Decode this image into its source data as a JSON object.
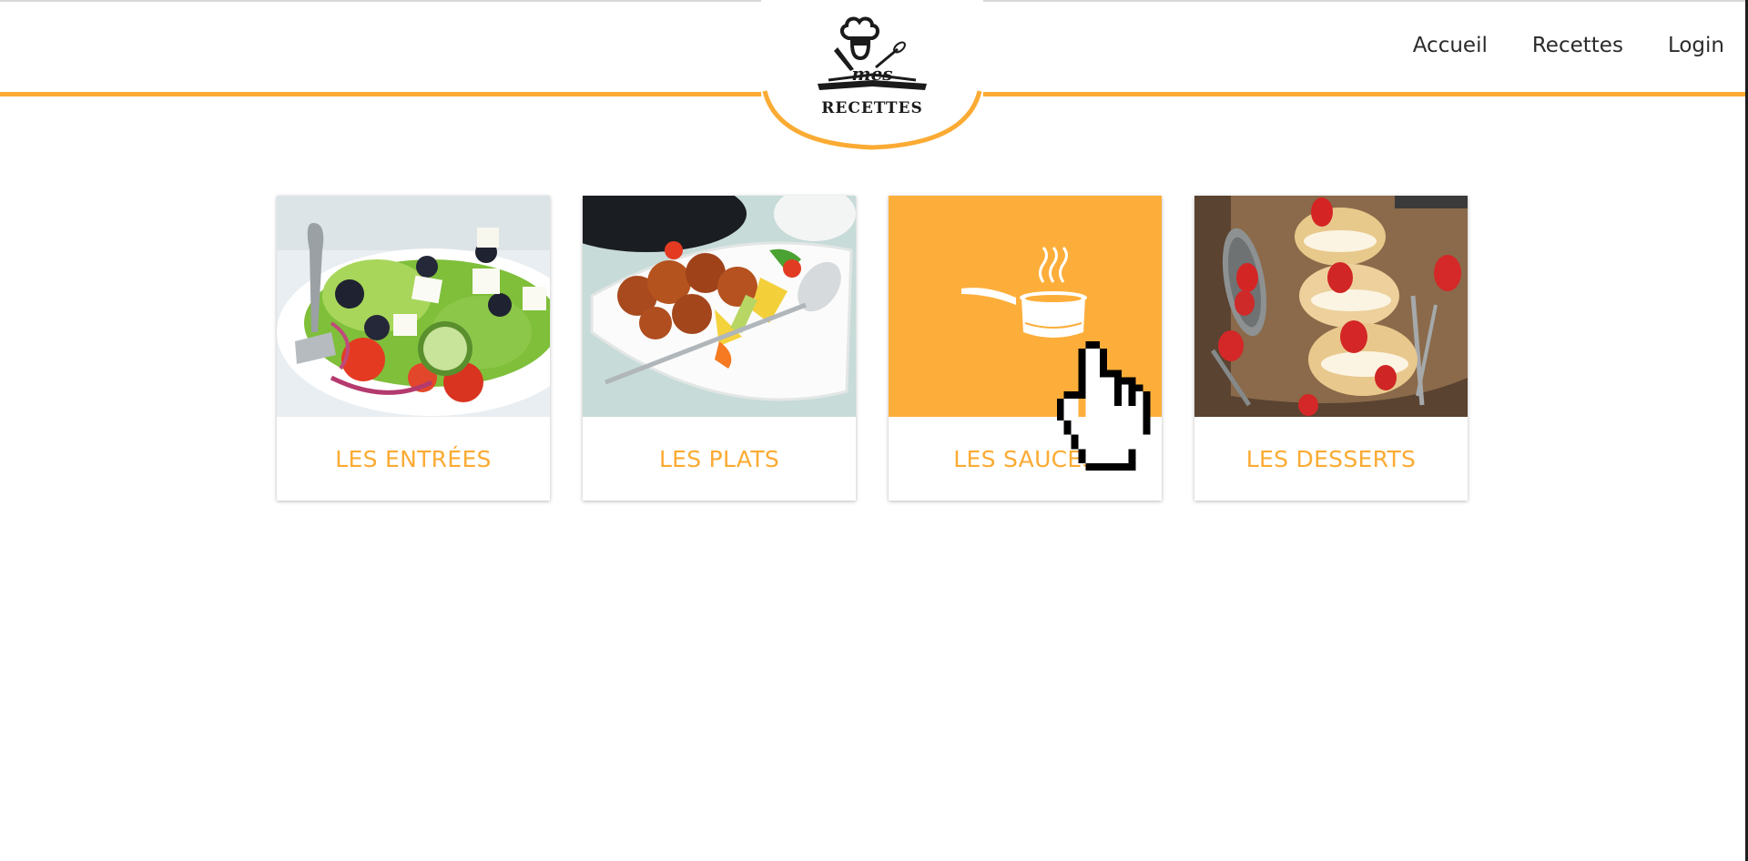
{
  "header": {
    "logo": {
      "top_text": "mes",
      "bottom_text": "RECETTES"
    },
    "nav": [
      {
        "label": "Accueil"
      },
      {
        "label": "Recettes"
      },
      {
        "label": "Login"
      }
    ],
    "accent_color": "#fbab33"
  },
  "categories": [
    {
      "label": "LES ENTRÉES",
      "image": "salad-photo"
    },
    {
      "label": "LES PLATS",
      "image": "sweet-sour-pork-photo"
    },
    {
      "label": "LES SAUCES",
      "image": "saucepan-icon",
      "hovered": true
    },
    {
      "label": "LES DESSERTS",
      "image": "cream-puffs-photo"
    }
  ],
  "cursor": {
    "type": "hand-pointer"
  }
}
